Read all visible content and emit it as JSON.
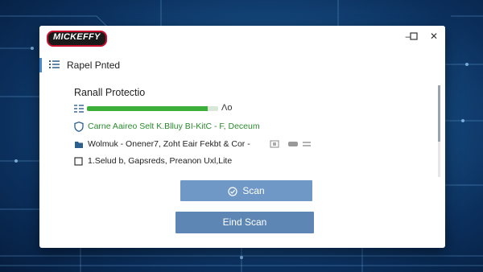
{
  "app": {
    "logo_text": "MICKEFFY",
    "window_controls": {
      "minimize_icon": "minimize-icon",
      "maximize_icon": "maximize-icon",
      "close_icon": "close-icon"
    }
  },
  "section": {
    "label": "Rapel Pnted",
    "icon": "list-icon"
  },
  "panel": {
    "title": "Ranall Protectio",
    "progress": {
      "fraction": 0.92,
      "end_text": "Λo",
      "icon": "scan-list-icon"
    },
    "rows": [
      {
        "icon": "shield-icon",
        "text": "Carne Aaireo Selt K.Blluy BI-KitC - F, Deceum",
        "style": "green"
      },
      {
        "icon": "folder-icon",
        "text": "Wolmuk - Onener7, Zoht Eair Fekbt & Cor -",
        "style": "dark"
      },
      {
        "icon": "checkbox-icon",
        "text": "1.Selud b, Gapsreds, Preanon Uxl,Lite",
        "style": "dark"
      }
    ]
  },
  "buttons": {
    "scan_label": "Scan",
    "end_scan_label": "Eind Scan"
  },
  "colors": {
    "accent": "#4a87c3",
    "progress": "#3cae3a",
    "green_text": "#2a8a2e",
    "scan_button": "#6f98c6",
    "end_button": "#5d86b4"
  }
}
